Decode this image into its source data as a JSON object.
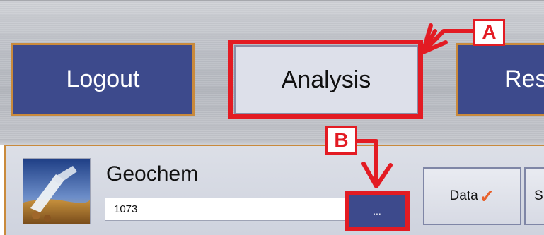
{
  "nav": {
    "logout_label": "Logout",
    "analysis_label": "Analysis",
    "results_label_visible": "Res"
  },
  "annotations": {
    "a_label": "A",
    "b_label": "B",
    "highlight_color": "#e31b23"
  },
  "panel": {
    "app_title": "Geochem",
    "id_value": "1073",
    "browse_label": "...",
    "data_tab_label": "Data",
    "data_tab_status_icon": "check-icon",
    "next_tab_label_visible": "S"
  },
  "colors": {
    "nav_button_bg": "#3d4a8c",
    "nav_button_border": "#c98a3c",
    "selected_button_bg": "#dde0ea",
    "check_color": "#e8612c"
  }
}
